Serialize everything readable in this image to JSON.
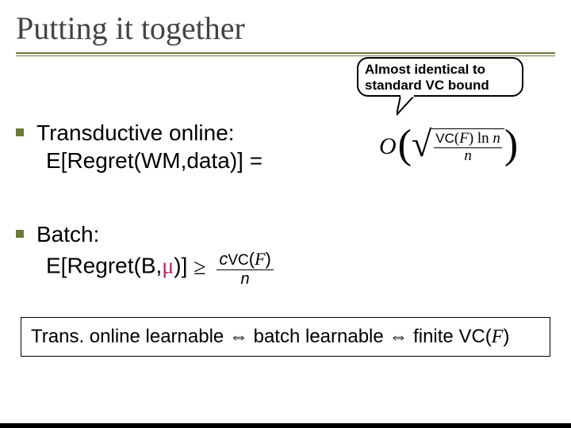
{
  "title": "Putting it together",
  "callout": {
    "line1": "Almost identical to",
    "line2": "standard VC bound"
  },
  "bullets": {
    "b1": {
      "line1": "Transductive online:",
      "line2_prefix": "E[Regret(WM,data)] ="
    },
    "b2": {
      "line1": "Batch:",
      "line2_prefix": "E[Regret(B,",
      "mu": "μ",
      "line2_suffix": ")]"
    }
  },
  "formula1": {
    "O": "O",
    "vc_label": "VC",
    "F": "F",
    "ln": "ln",
    "n_top": "n",
    "n_bottom": "n"
  },
  "formula2": {
    "geq": "≥",
    "c": "c",
    "vc_label": "VC",
    "F": "F",
    "n": "n"
  },
  "bottom": {
    "t1": "Trans. online learnable ",
    "arr": "⇔",
    "t2": " batch learnable ",
    "t3": " finite VC(",
    "F": "F",
    "t4": ")"
  }
}
